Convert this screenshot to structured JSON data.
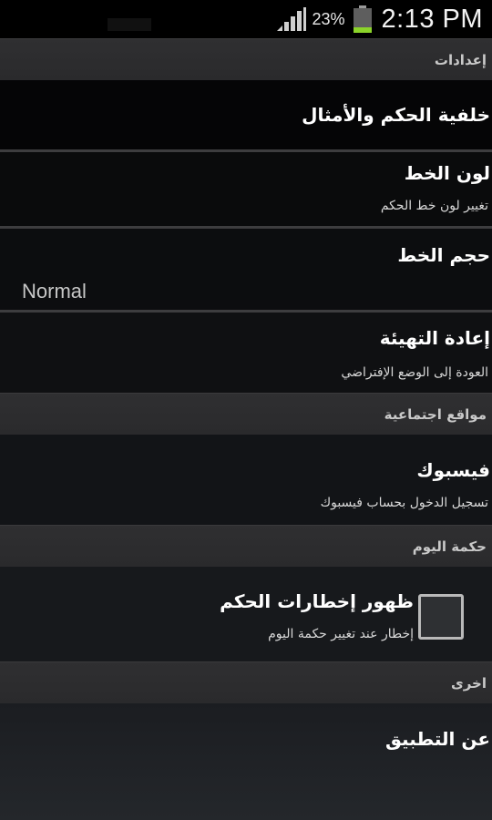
{
  "status_bar": {
    "battery_percent": "23%",
    "time": "2:13 PM"
  },
  "sections": {
    "settings": "إعدادات",
    "social": "مواقع اجتماعية",
    "daily_wisdom": "حكمة اليوم",
    "other": "اخرى"
  },
  "items": {
    "background": {
      "title": "خلفية الحكم والأمثال"
    },
    "font_color": {
      "title": "لون الخط",
      "summary": "تغيير لون خط الحكم"
    },
    "font_size": {
      "title": "حجم الخط",
      "value": "Normal"
    },
    "reset": {
      "title": "إعادة التهيئة",
      "summary": "العودة إلى الوضع الإفتراضي"
    },
    "facebook": {
      "title": "فيسبوك",
      "summary": "تسجيل الدخول بحساب فيسبوك"
    },
    "notifications": {
      "title": "ظهور إخطارات الحكم",
      "summary": "إخطار عند تغيير حكمة اليوم",
      "checked": false
    },
    "about": {
      "title": "عن التطبيق"
    }
  }
}
